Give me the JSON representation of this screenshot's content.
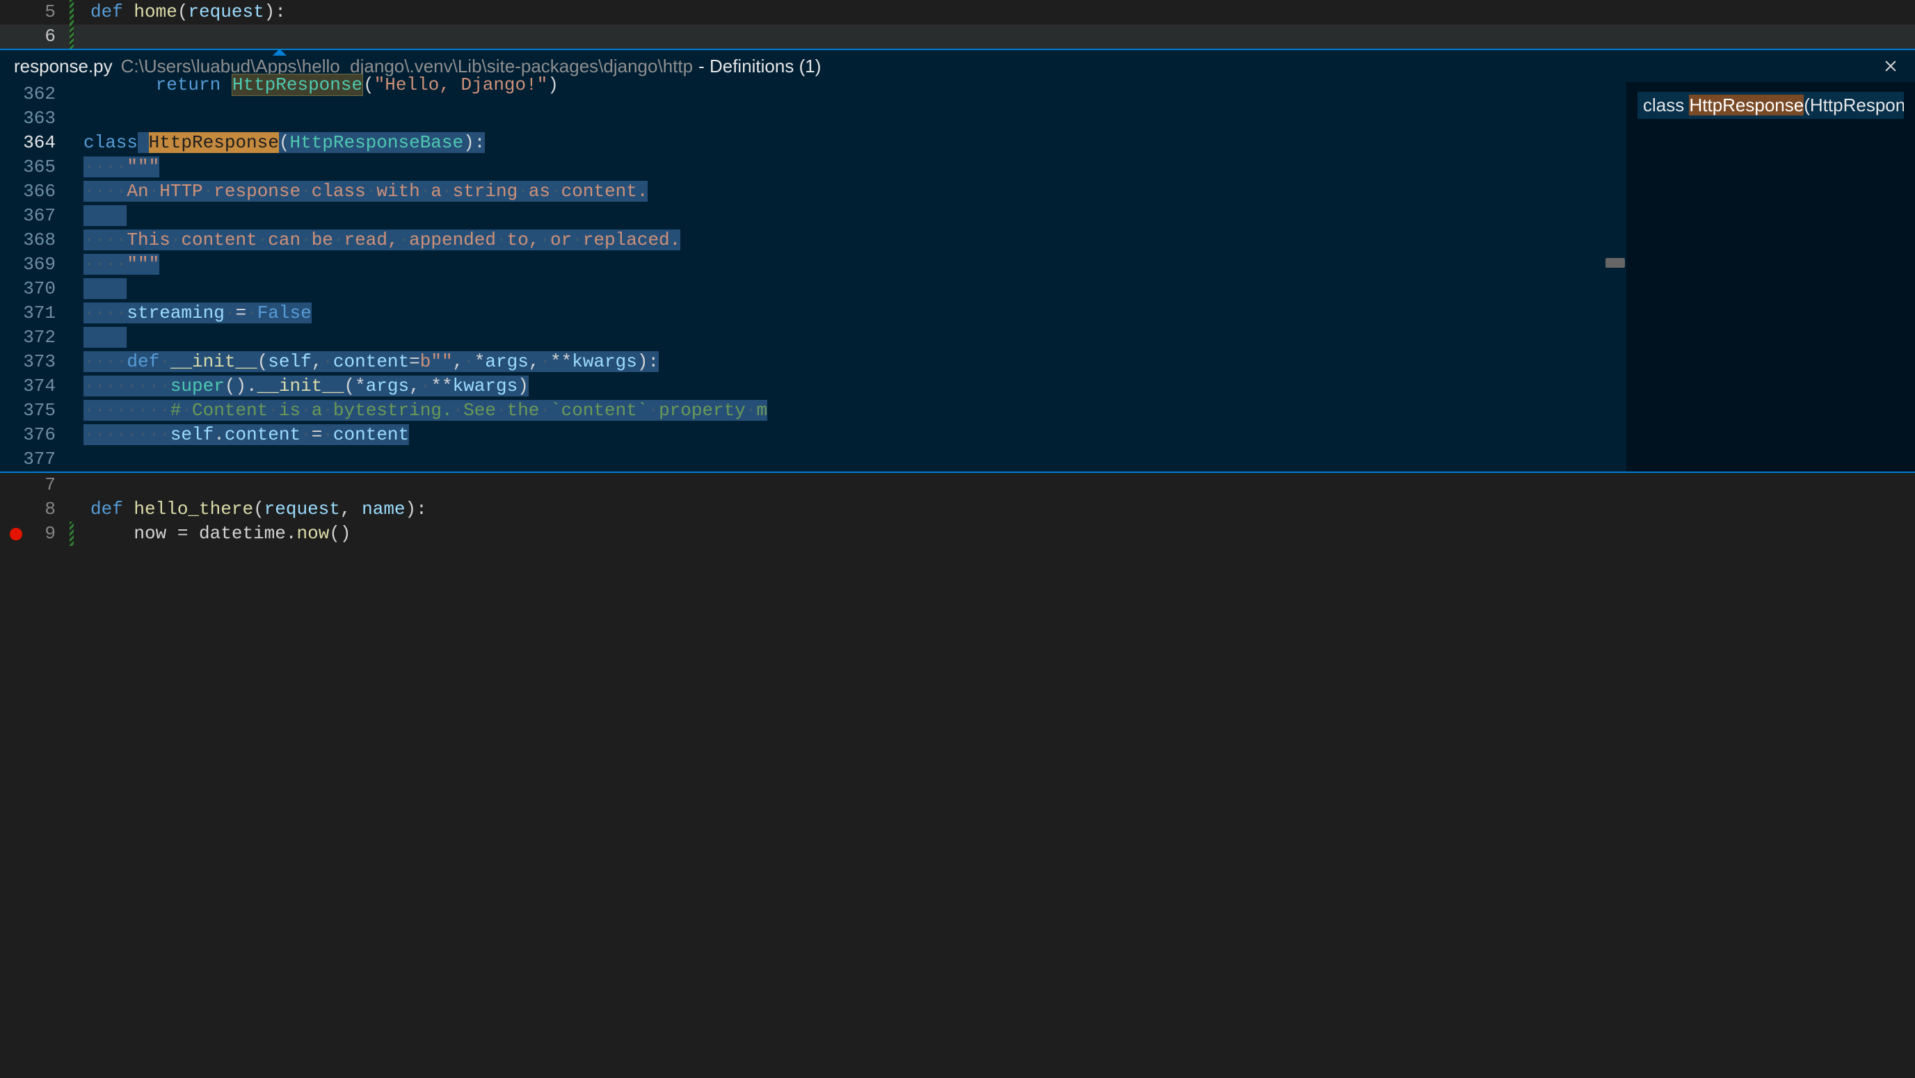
{
  "top_editor": {
    "lines": [
      {
        "num": "5",
        "tokens": [
          {
            "t": "def ",
            "c": "tok-kw"
          },
          {
            "t": "home",
            "c": "tok-fn"
          },
          {
            "t": "(",
            "c": "tok-punc"
          },
          {
            "t": "request",
            "c": "tok-var"
          },
          {
            "t": "):",
            "c": "tok-punc"
          }
        ]
      },
      {
        "num": "6",
        "hl": true,
        "bulb": true,
        "tokens": [
          {
            "t": "return",
            "c": "tok-kw"
          },
          {
            "t": " ",
            "c": ""
          },
          {
            "t": "HttpResponse",
            "c": "tok-cls ref-hl"
          },
          {
            "t": "(",
            "c": "tok-punc"
          },
          {
            "t": "\"Hello, Django!\"",
            "c": "tok-str"
          },
          {
            "t": ")",
            "c": "tok-punc"
          }
        ]
      }
    ]
  },
  "peek": {
    "file": "response.py",
    "path": "C:\\Users\\luabud\\Apps\\hello_django\\.venv\\Lib\\site-packages\\django\\http",
    "defs": "- Definitions (1)",
    "ref_prefix": "class ",
    "ref_match": "HttpResponse",
    "ref_suffix": "(HttpResponseBa",
    "lines": [
      {
        "num": "362",
        "html": ""
      },
      {
        "num": "363",
        "html": ""
      },
      {
        "num": "364",
        "active": true,
        "html": "<span class='tok-kw'>class</span><span class='sel'> </span><span class='def-hl sel'>HttpResponse</span><span class='sel'><span class='tok-punc'>(</span><span class='tok-cls'>HttpResponseBase</span><span class='tok-punc'>):</span></span>"
      },
      {
        "num": "365",
        "html": "<span class='sel'><span class='ws-dot'>····</span><span class='tok-str'>\"\"\"</span></span>"
      },
      {
        "num": "366",
        "html": "<span class='sel'><span class='ws-dot'>····</span><span class='tok-str'>An</span><span class='ws-dot'>·</span><span class='tok-str'>HTTP</span><span class='ws-dot'>·</span><span class='tok-str'>response</span><span class='ws-dot'>·</span><span class='tok-str'>class</span><span class='ws-dot'>·</span><span class='tok-str'>with</span><span class='ws-dot'>·</span><span class='tok-str'>a</span><span class='ws-dot'>·</span><span class='tok-str'>string</span><span class='ws-dot'>·</span><span class='tok-str'>as</span><span class='ws-dot'>·</span><span class='tok-str'>content.</span></span>"
      },
      {
        "num": "367",
        "html": "<span class='sel'>    </span>"
      },
      {
        "num": "368",
        "html": "<span class='sel'><span class='ws-dot'>····</span><span class='tok-str'>This</span><span class='ws-dot'>·</span><span class='tok-str'>content</span><span class='ws-dot'>·</span><span class='tok-str'>can</span><span class='ws-dot'>·</span><span class='tok-str'>be</span><span class='ws-dot'>·</span><span class='tok-str'>read,</span><span class='ws-dot'>·</span><span class='tok-str'>appended</span><span class='ws-dot'>·</span><span class='tok-str'>to,</span><span class='ws-dot'>·</span><span class='tok-str'>or</span><span class='ws-dot'>·</span><span class='tok-str'>replaced.</span></span>"
      },
      {
        "num": "369",
        "html": "<span class='sel'><span class='ws-dot'>····</span><span class='tok-str'>\"\"\"</span></span>"
      },
      {
        "num": "370",
        "html": "<span class='sel'>    </span>"
      },
      {
        "num": "371",
        "html": "<span class='sel'><span class='ws-dot'>····</span><span class='tok-var'>streaming</span><span class='ws-dot'>·</span><span class='tok-punc'>=</span><span class='ws-dot'>·</span><span class='tok-const'>False</span></span>"
      },
      {
        "num": "372",
        "html": "<span class='sel'>    </span>"
      },
      {
        "num": "373",
        "html": "<span class='sel'><span class='ws-dot'>····</span><span class='tok-kw'>def</span><span class='ws-dot'>·</span><span class='tok-fn'>__init__</span><span class='tok-punc'>(</span><span class='tok-var'>self</span><span class='tok-punc'>,</span><span class='ws-dot'>·</span><span class='tok-var'>content</span><span class='tok-punc'>=</span><span class='tok-str'>b\"\"</span><span class='tok-punc'>,</span><span class='ws-dot'>·</span><span class='tok-punc'>*</span><span class='tok-var'>args</span><span class='tok-punc'>,</span><span class='ws-dot'>·</span><span class='tok-punc'>**</span><span class='tok-var'>kwargs</span><span class='tok-punc'>):</span></span>"
      },
      {
        "num": "374",
        "html": "<span class='sel'><span class='ws-dot'>········</span><span class='tok-cls'>super</span><span class='tok-punc'>().</span><span class='tok-fn'>__init__</span><span class='tok-punc'>(*</span><span class='tok-var'>args</span><span class='tok-punc'>,</span><span class='ws-dot'>·</span><span class='tok-punc'>**</span><span class='tok-var'>kwargs</span><span class='tok-punc'>)</span></span>"
      },
      {
        "num": "375",
        "html": "<span class='sel'><span class='ws-dot'>········</span><span class='tok-comment'>#</span><span class='ws-dot'>·</span><span class='tok-comment'>Content</span><span class='ws-dot'>·</span><span class='tok-comment'>is</span><span class='ws-dot'>·</span><span class='tok-comment'>a</span><span class='ws-dot'>·</span><span class='tok-comment'>bytestring.</span><span class='ws-dot'>·</span><span class='tok-comment'>See</span><span class='ws-dot'>·</span><span class='tok-comment'>the</span><span class='ws-dot'>·</span><span class='tok-comment'>`content`</span><span class='ws-dot'>·</span><span class='tok-comment'>property</span><span class='ws-dot'>·</span><span class='tok-comment'>m</span></span>"
      },
      {
        "num": "376",
        "html": "<span class='sel'><span class='ws-dot'>········</span><span class='tok-var'>self</span><span class='tok-punc'>.</span><span class='tok-var'>content</span><span class='ws-dot'>·</span><span class='tok-punc'>=</span><span class='ws-dot'>·</span><span class='tok-var'>content</span></span>"
      },
      {
        "num": "377",
        "html": ""
      }
    ]
  },
  "bottom_editor": {
    "lines": [
      {
        "num": "7",
        "tokens": []
      },
      {
        "num": "8",
        "tokens": [
          {
            "t": "def ",
            "c": "tok-kw"
          },
          {
            "t": "hello_there",
            "c": "tok-fn"
          },
          {
            "t": "(",
            "c": "tok-punc"
          },
          {
            "t": "request",
            "c": "tok-var"
          },
          {
            "t": ", ",
            "c": "tok-punc"
          },
          {
            "t": "name",
            "c": "tok-var"
          },
          {
            "t": "):",
            "c": "tok-punc"
          }
        ]
      },
      {
        "num": "9",
        "bp": true,
        "tokens": [
          {
            "t": "    now ",
            "c": ""
          },
          {
            "t": "=",
            "c": "tok-punc"
          },
          {
            "t": " datetime",
            "c": ""
          },
          {
            "t": ".",
            "c": "tok-punc"
          },
          {
            "t": "now",
            "c": "tok-fn"
          },
          {
            "t": "()",
            "c": "tok-punc"
          }
        ]
      }
    ]
  }
}
